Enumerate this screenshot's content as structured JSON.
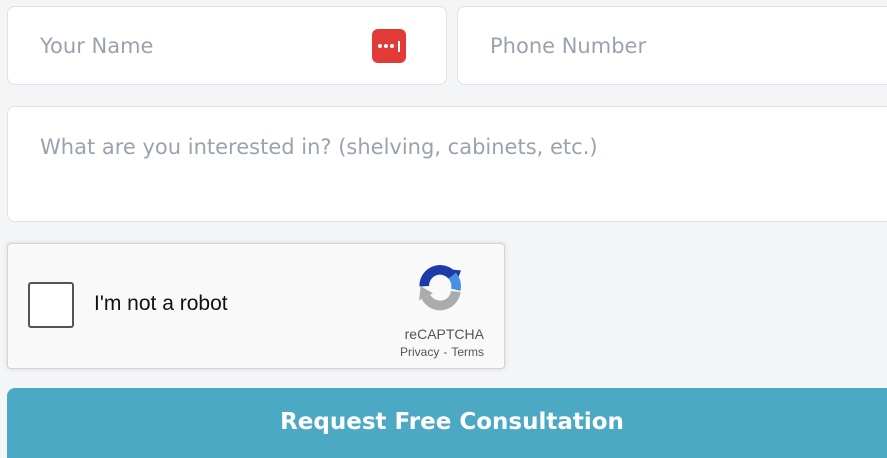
{
  "form": {
    "name_placeholder": "Your Name",
    "name_value": "",
    "phone_placeholder": "Phone Number",
    "phone_value": "",
    "interest_placeholder": "What are you interested in? (shelving, cabinets, etc.)",
    "interest_value": "",
    "submit_label": "Request Free Consultation"
  },
  "password_manager_icon": "password-dots-icon",
  "recaptcha": {
    "label": "I'm not a robot",
    "brand": "reCAPTCHA",
    "privacy_link": "Privacy",
    "separator": "-",
    "terms_link": "Terms",
    "checked": false
  },
  "colors": {
    "accent": "#4ca9c4",
    "password_icon_bg": "#e23b37",
    "field_border": "#dfe2e6",
    "background": "#f4f5f7"
  }
}
